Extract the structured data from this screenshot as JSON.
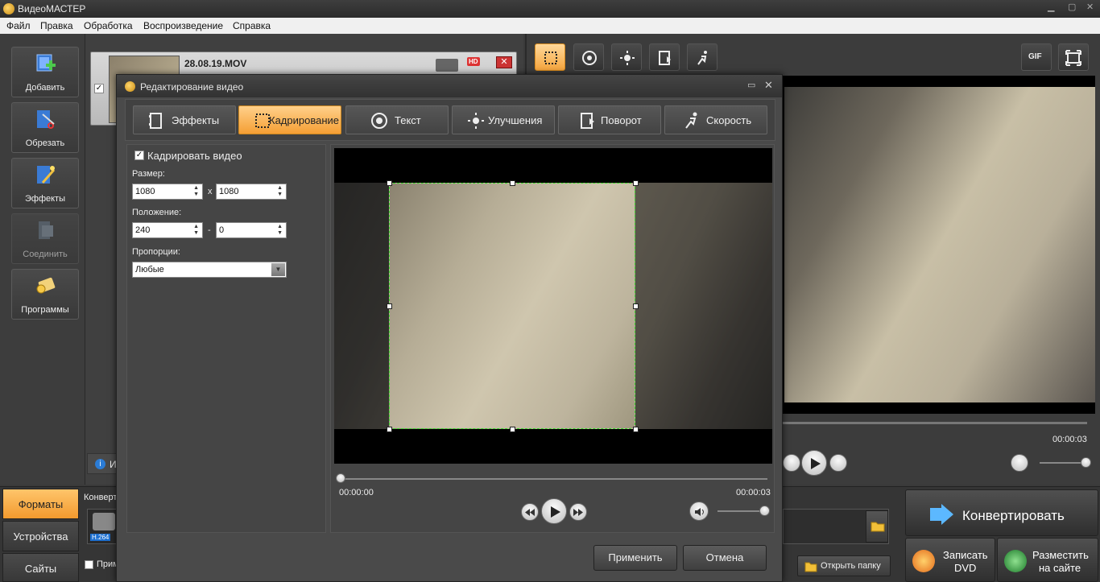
{
  "app": {
    "title": "ВидеоМАСТЕР"
  },
  "menu": [
    "Файл",
    "Правка",
    "Обработка",
    "Воспроизведение",
    "Справка"
  ],
  "left_toolbar": [
    {
      "label": "Добавить",
      "icon": "add-video-icon",
      "enabled": true
    },
    {
      "label": "Обрезать",
      "icon": "scissors-icon",
      "enabled": true
    },
    {
      "label": "Эффекты",
      "icon": "magic-wand-icon",
      "enabled": true
    },
    {
      "label": "Соединить",
      "icon": "join-icon",
      "enabled": false
    },
    {
      "label": "Программы",
      "icon": "programs-icon",
      "enabled": true
    }
  ],
  "file": {
    "name": "28.08.19.MOV",
    "badge": "HD"
  },
  "info_stub": "И",
  "bottom_tabs": [
    {
      "label": "Форматы",
      "active": true
    },
    {
      "label": "Устройства",
      "active": false
    },
    {
      "label": "Сайты",
      "active": false
    }
  ],
  "convert_stub": "Конверт",
  "codec_badge": "H.264",
  "apply_all_stub": "Прим",
  "right_toolbar": [
    {
      "icon": "crop-icon",
      "active": true
    },
    {
      "icon": "text-icon",
      "active": false
    },
    {
      "icon": "brightness-icon",
      "active": false
    },
    {
      "icon": "rotate-icon",
      "active": false
    },
    {
      "icon": "speed-icon",
      "active": false
    }
  ],
  "gif_label": "GIF",
  "preview_time": "00:00:03",
  "open_folder": "Открыть папку",
  "convert_button": "Конвертировать",
  "dvd_button": {
    "line1": "Записать",
    "line2": "DVD"
  },
  "site_button": {
    "line1": "Разместить",
    "line2": "на сайте"
  },
  "dialog": {
    "title": "Редактирование видео",
    "tabs": [
      {
        "label": "Эффекты",
        "icon": "film-effects-icon",
        "active": false
      },
      {
        "label": "Кадрирование",
        "icon": "crop-icon",
        "active": true
      },
      {
        "label": "Текст",
        "icon": "text-icon",
        "active": false
      },
      {
        "label": "Улучшения",
        "icon": "brightness-icon",
        "active": false
      },
      {
        "label": "Поворот",
        "icon": "rotate-icon",
        "active": false
      },
      {
        "label": "Скорость",
        "icon": "speed-icon",
        "active": false
      }
    ],
    "crop_checkbox_label": "Кадрировать видео",
    "size_label": "Размер:",
    "width": "1080",
    "height": "1080",
    "size_sep": "x",
    "position_label": "Положение:",
    "pos_x": "240",
    "pos_y": "0",
    "pos_sep": "-",
    "ratio_label": "Пропорции:",
    "ratio_value": "Любые",
    "time_start": "00:00:00",
    "time_end": "00:00:03",
    "apply_button": "Применить",
    "cancel_button": "Отмена"
  },
  "colors": {
    "accent": "#f5a53e",
    "crop_border": "#3ddc2e"
  }
}
